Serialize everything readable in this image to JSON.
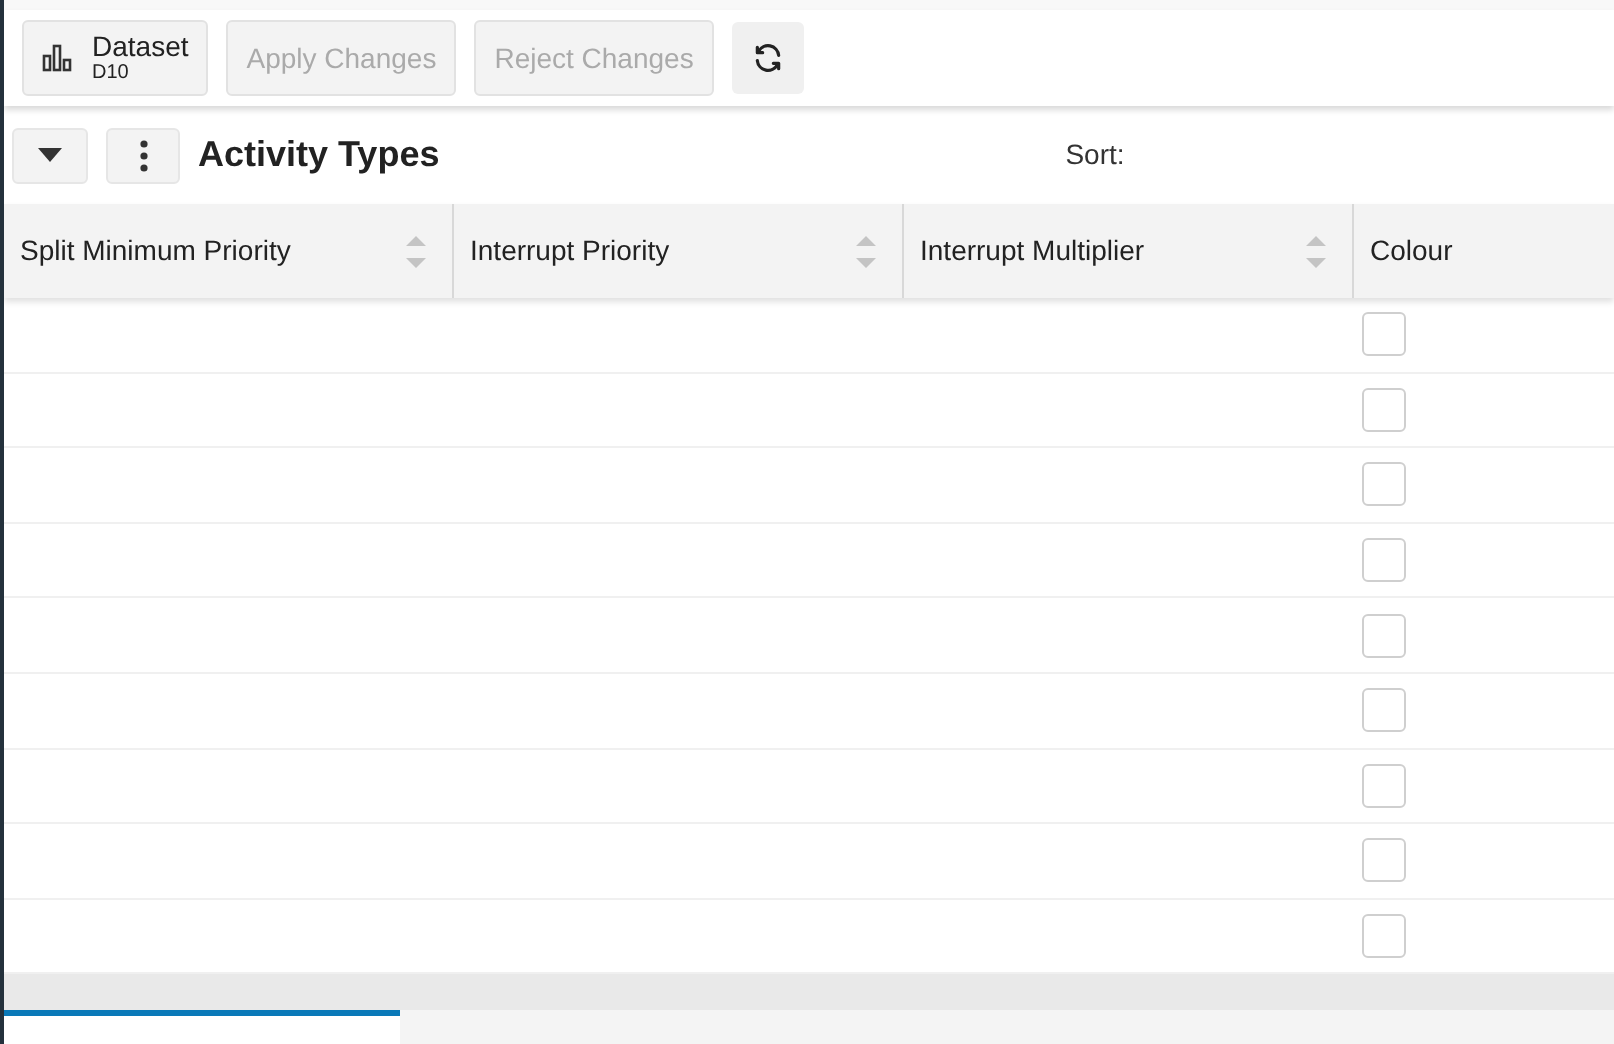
{
  "toolbar": {
    "dataset": {
      "label": "Dataset",
      "sub": "D10"
    },
    "buttons": [
      {
        "label": "Apply Changes",
        "disabled": true
      },
      {
        "label": "Reject Changes",
        "disabled": true
      }
    ]
  },
  "panel": {
    "title": "Activity Types",
    "sort_label": "Sort:"
  },
  "table": {
    "columns": [
      {
        "label": "Split Minimum Priority",
        "sortable": true
      },
      {
        "label": "Interrupt Priority",
        "sortable": true
      },
      {
        "label": "Interrupt Multiplier",
        "sortable": true
      },
      {
        "label": "Colour",
        "sortable": false
      }
    ],
    "rows": [
      {
        "checked": false
      },
      {
        "checked": false
      },
      {
        "checked": false
      },
      {
        "checked": false
      },
      {
        "checked": false
      },
      {
        "checked": false
      },
      {
        "checked": false
      },
      {
        "checked": false
      },
      {
        "checked": false
      }
    ]
  }
}
